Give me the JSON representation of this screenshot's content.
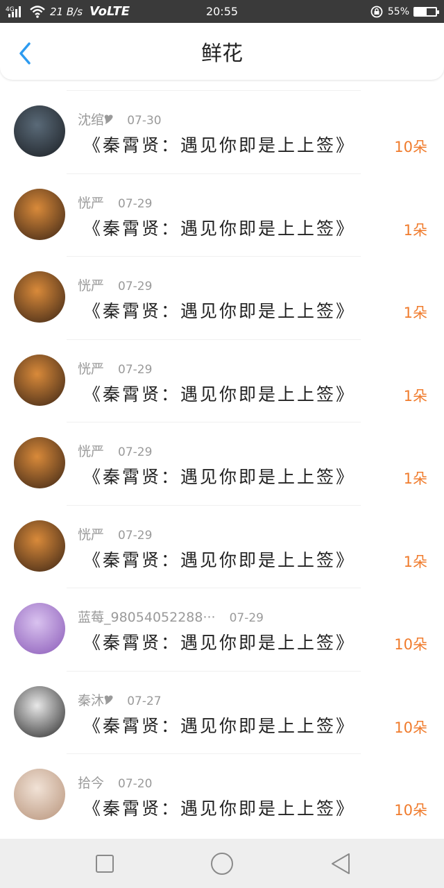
{
  "status_bar": {
    "network_label": "4G",
    "speed": "21 B/s",
    "volte": "VoLTE",
    "time": "20:55",
    "battery": "55%",
    "battery_level": 0.55
  },
  "header": {
    "title": "鲜花",
    "back_icon": "chevron-left-icon",
    "accent_color": "#2d9bf0"
  },
  "gifts": [
    {
      "user": "沈绾🎔",
      "date": "07-30",
      "message": "《秦霄贤：遇见你即是上上签》",
      "amount": "10朵",
      "avatar_colors": [
        "#5a6a78",
        "#1b1f24"
      ]
    },
    {
      "user": "恍严",
      "date": "07-29",
      "message": "《秦霄贤：遇见你即是上上签》",
      "amount": "1朵",
      "avatar_colors": [
        "#d98a3a",
        "#3a2415"
      ]
    },
    {
      "user": "恍严",
      "date": "07-29",
      "message": "《秦霄贤：遇见你即是上上签》",
      "amount": "1朵",
      "avatar_colors": [
        "#d98a3a",
        "#3a2415"
      ]
    },
    {
      "user": "恍严",
      "date": "07-29",
      "message": "《秦霄贤：遇见你即是上上签》",
      "amount": "1朵",
      "avatar_colors": [
        "#d98a3a",
        "#3a2415"
      ]
    },
    {
      "user": "恍严",
      "date": "07-29",
      "message": "《秦霄贤：遇见你即是上上签》",
      "amount": "1朵",
      "avatar_colors": [
        "#d98a3a",
        "#3a2415"
      ]
    },
    {
      "user": "恍严",
      "date": "07-29",
      "message": "《秦霄贤：遇见你即是上上签》",
      "amount": "1朵",
      "avatar_colors": [
        "#d98a3a",
        "#3a2415"
      ]
    },
    {
      "user": "蓝莓_98054052288···",
      "date": "07-29",
      "message": "《秦霄贤：遇见你即是上上签》",
      "amount": "10朵",
      "avatar_colors": [
        "#d9c2ef",
        "#8a5ab8"
      ]
    },
    {
      "user": "秦沐🎔",
      "date": "07-27",
      "message": "《秦霄贤：遇见你即是上上签》",
      "amount": "10朵",
      "avatar_colors": [
        "#e8e8e8",
        "#2a2a2a"
      ]
    },
    {
      "user": "拾今",
      "date": "07-20",
      "message": "《秦霄贤：遇见你即是上上签》",
      "amount": "10朵",
      "avatar_colors": [
        "#f1e2d6",
        "#b7937a"
      ]
    }
  ],
  "nav_bar": {
    "recents_icon": "square-icon",
    "home_icon": "circle-icon",
    "back_icon": "triangle-back-icon"
  }
}
